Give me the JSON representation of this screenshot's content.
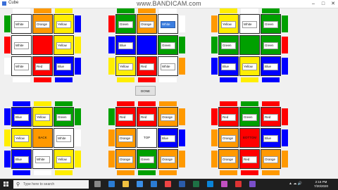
{
  "window": {
    "title": "Cube",
    "watermark": "www.BANDICAM.com"
  },
  "colors": {
    "White": "#ffffff",
    "Yellow": "#ffee00",
    "Orange": "#ff9900",
    "Red": "#ff0000",
    "Green": "#00a000",
    "Blue": "#0000ff"
  },
  "done_label": "DONE",
  "faces": [
    {
      "id": "face-1",
      "cells": [
        "White",
        "Orange",
        "Yellow",
        "White",
        "Red",
        "Yellow",
        "White",
        "Red",
        "Blue"
      ],
      "center_text": "",
      "edges": {
        "top": [
          "White",
          "Orange",
          "Yellow"
        ],
        "left": [
          "Green",
          "Red",
          "White"
        ],
        "right": [
          "Blue",
          "Yellow",
          "Blue"
        ],
        "bottom": [
          "White",
          "Red",
          "Blue"
        ]
      }
    },
    {
      "id": "face-2",
      "cells": [
        "Green",
        "Orange",
        "White",
        "Blue",
        "Blue",
        "Green",
        "Yellow",
        "Red",
        "White"
      ],
      "center_text": "",
      "edges": {
        "top": [
          "Green",
          "Orange",
          "White"
        ],
        "left": [
          "Red",
          "Blue",
          "Yellow"
        ],
        "right": [
          "White",
          "Green",
          "Orange"
        ],
        "bottom": [
          "Yellow",
          "Red",
          "White"
        ]
      }
    },
    {
      "id": "face-3",
      "cells": [
        "Yellow",
        "White",
        "Green",
        "Green",
        "Green",
        "Green",
        "Blue",
        "Yellow",
        "Blue"
      ],
      "center_text": "",
      "edges": {
        "top": [
          "Yellow",
          "White",
          "Green"
        ],
        "left": [
          "Orange",
          "Green",
          "Blue"
        ],
        "right": [
          "Green",
          "Red",
          "Blue"
        ],
        "bottom": [
          "Blue",
          "Yellow",
          "Blue"
        ]
      }
    },
    {
      "id": "face-4",
      "cells": [
        "Blue",
        "Yellow",
        "Green",
        "Yellow",
        "Orange",
        "White",
        "Blue",
        "White",
        "Yellow"
      ],
      "center_text": "BACK",
      "edges": {
        "top": [
          "Blue",
          "Yellow",
          "Green"
        ],
        "left": [
          "Blue",
          "Yellow",
          "Blue"
        ],
        "right": [
          "Green",
          "White",
          "Yellow"
        ],
        "bottom": [
          "Blue",
          "White",
          "Yellow"
        ]
      }
    },
    {
      "id": "face-5",
      "cells": [
        "Red",
        "Red",
        "Orange",
        "Orange",
        "White",
        "Blue",
        "Orange",
        "Green",
        "Orange"
      ],
      "center_text": "TOP",
      "edges": {
        "top": [
          "Red",
          "Red",
          "Orange"
        ],
        "left": [
          "Green",
          "Orange",
          "Orange"
        ],
        "right": [
          "Orange",
          "Blue",
          "Orange"
        ],
        "bottom": [
          "Orange",
          "Green",
          "Orange"
        ]
      }
    },
    {
      "id": "face-6",
      "cells": [
        "Red",
        "Green",
        "Red",
        "Orange",
        "Red",
        "Blue",
        "Orange",
        "Red",
        "Orange"
      ],
      "center_text": "BOTTOM",
      "edges": {
        "top": [
          "Red",
          "Green",
          "Red"
        ],
        "left": [
          "Red",
          "Orange",
          "Orange"
        ],
        "right": [
          "Red",
          "Blue",
          "Orange"
        ],
        "bottom": [
          "Orange",
          "Red",
          "Orange"
        ]
      }
    }
  ],
  "selected_cell": {
    "face": 1,
    "cell": 2
  },
  "taskbar": {
    "search_placeholder": "Type here to search",
    "time": "2:16 PM",
    "date": "7/20/2020",
    "icons": [
      "task-view-icon",
      "edge-icon",
      "file-explorer-icon",
      "store-icon",
      "mail-icon",
      "chrome-icon",
      "word-icon",
      "excel-icon",
      "photos-icon",
      "media-icon",
      "bandicam-icon",
      "visual-studio-icon"
    ]
  }
}
